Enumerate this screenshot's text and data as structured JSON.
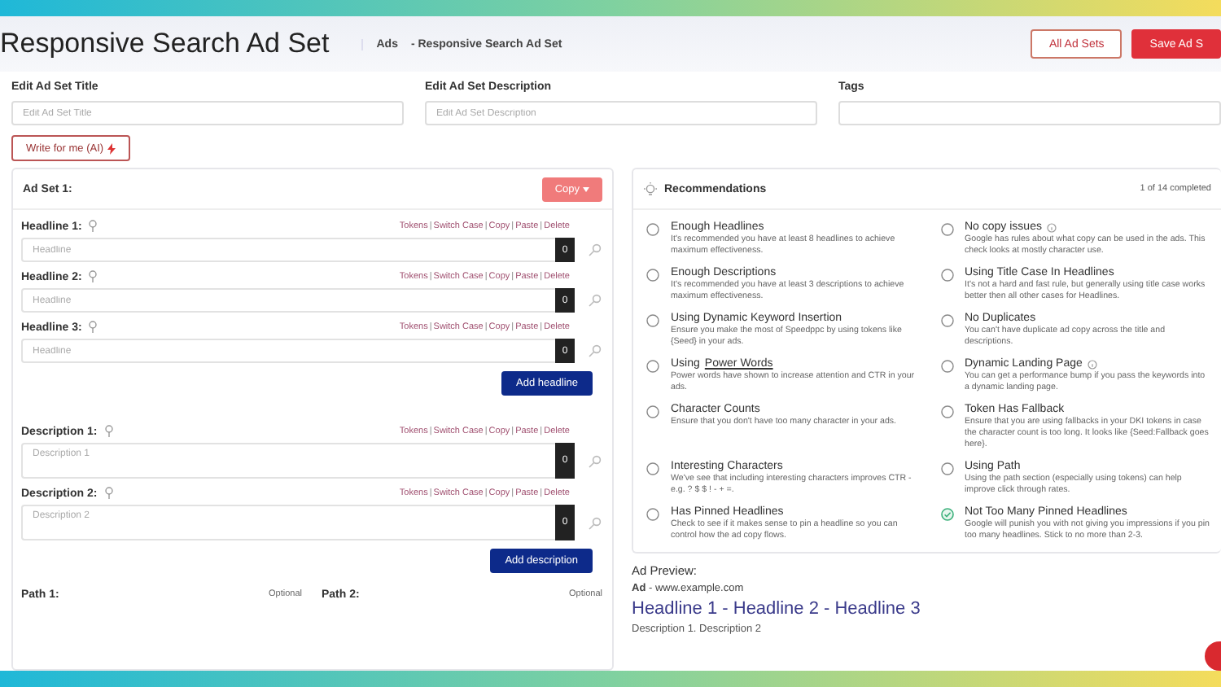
{
  "header": {
    "title": "Responsive Search Ad Set",
    "breadcrumb": [
      "Ads",
      "- Responsive Search Ad Set"
    ],
    "buttons": [
      {
        "label": "All Ad Sets",
        "kind": "outline"
      },
      {
        "label": "Save Ad S",
        "kind": "primary"
      }
    ]
  },
  "fields": [
    {
      "label": "Edit Ad Set Title",
      "placeholder": "Edit Ad Set Title"
    },
    {
      "label": "Edit Ad Set Description",
      "placeholder": "Edit Ad Set Description"
    },
    {
      "label": "Tags"
    }
  ],
  "ai_button": "Write for me (AI)",
  "ad_set": {
    "title": "Ad Set 1:",
    "copy_button": "Copy",
    "separator": "|",
    "headlines": [
      {
        "label": "Headline 1:",
        "placeholder": "Headline",
        "count": "0",
        "actions": [
          "Tokens",
          "Switch Case",
          "Copy",
          "Paste",
          "Delete"
        ]
      },
      {
        "label": "Headline 2:",
        "placeholder": "Headline",
        "count": "0",
        "actions": [
          "Tokens",
          "Switch Case",
          "Copy",
          "Paste",
          "Delete"
        ]
      },
      {
        "label": "Headline 3:",
        "placeholder": "Headline",
        "count": "0",
        "actions": [
          "Tokens",
          "Switch Case",
          "Copy",
          "Paste",
          "Delete"
        ]
      }
    ],
    "add_headline": "Add headline",
    "descriptions": [
      {
        "label": "Description 1:",
        "placeholder": "Description 1",
        "count": "0",
        "actions": [
          "Tokens",
          "Switch Case",
          "Copy",
          "Paste",
          "Delete"
        ]
      },
      {
        "label": "Description 2:",
        "placeholder": "Description 2",
        "count": "0",
        "actions": [
          "Tokens",
          "Switch Case",
          "Copy",
          "Paste",
          "Delete"
        ]
      }
    ],
    "add_description": "Add description",
    "paths": [
      {
        "label": "Path 1:",
        "hint": "Optional"
      },
      {
        "label": "Path 2:",
        "hint": "Optional"
      }
    ]
  },
  "recommendations": {
    "title": "Recommendations",
    "progress": "1 of 14 completed",
    "items": [
      {
        "title": "Enough Headlines",
        "description": "It's recommended you have at least 8 headlines to achieve maximum effectiveness.",
        "checked": false,
        "info": false
      },
      {
        "title": "No copy issues",
        "description": "Google has rules about what copy can be used in the ads. This check looks at mostly character use.",
        "checked": false,
        "info": true
      },
      {
        "title": "Enough Descriptions",
        "description": "It's recommended you have at least 3 descriptions to achieve maximum effectiveness.",
        "checked": false,
        "info": false
      },
      {
        "title": "Using Title Case In Headlines",
        "description": "It's not a hard and fast rule, but generally using title case works better then all other cases for Headlines.",
        "checked": false,
        "info": false
      },
      {
        "title": "Using Dynamic Keyword Insertion",
        "description": "Ensure you make the most of Speedppc by using tokens like {Seed} in your ads.",
        "checked": false,
        "info": false
      },
      {
        "title": "No Duplicates",
        "description": "You can't have duplicate ad copy across the title and descriptions.",
        "checked": false,
        "info": false
      },
      {
        "title": "Using",
        "link": "Power Words",
        "description": "Power words have shown to increase attention and CTR in your ads.",
        "checked": false,
        "info": false
      },
      {
        "title": "Dynamic Landing Page",
        "description": "You can get a performance bump if you pass the keywords into a dynamic landing page.",
        "checked": false,
        "info": true
      },
      {
        "title": "Character Counts",
        "description": "Ensure that you don't have too many character in your ads.",
        "checked": false,
        "info": false
      },
      {
        "title": "Token Has Fallback",
        "description": "Ensure that you are using fallbacks in your DKI tokens in case the character count is too long. It looks like {Seed:Fallback goes here}.",
        "checked": false,
        "info": false
      },
      {
        "title": "Interesting Characters",
        "description": "We've see that including interesting characters improves CTR - e.g. ? $ $ ! - + =.",
        "checked": false,
        "info": false
      },
      {
        "title": "Using Path",
        "description": "Using the path section (especially using tokens) can help improve click through rates.",
        "checked": false,
        "info": false
      },
      {
        "title": "Has Pinned Headlines",
        "description": "Check to see if it makes sense to pin a headline so you can control how the ad copy flows.",
        "checked": false,
        "info": false
      },
      {
        "title": "Not Too Many Pinned Headlines",
        "description": "Google will punish you with not giving you impressions if you pin too many headlines. Stick to no more than 2-3.",
        "checked": true,
        "info": false
      }
    ]
  },
  "preview": {
    "title": "Ad Preview:",
    "url": "**Ad** - www.example.com",
    "headline": "Headline 1 - Headline 2 - Headline 3",
    "description": "Description 1. Description 2"
  }
}
